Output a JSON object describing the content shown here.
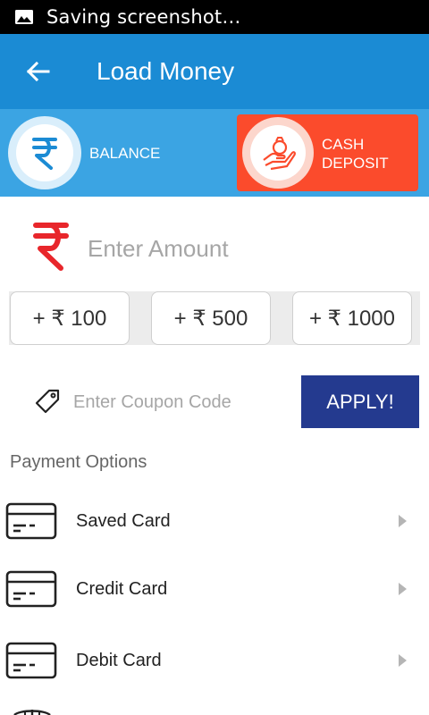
{
  "status_bar": {
    "icon": "image-icon",
    "text": "Saving screenshot…"
  },
  "app_bar": {
    "back_icon": "arrow-left-icon",
    "title": "Load Money",
    "color": "#1b8bd4"
  },
  "wallet_strip": {
    "color": "#3ba4e3",
    "balance": {
      "icon": "rupee-icon",
      "label": "BALANCE"
    },
    "cash_deposit": {
      "icon": "money-bag-hand-icon",
      "label_line1": "CASH",
      "label_line2": "DEPOSIT",
      "color": "#fb4b2c"
    }
  },
  "amount": {
    "icon": "rupee-icon",
    "placeholder": "Enter Amount",
    "value": "",
    "icon_color": "#e8262b"
  },
  "quick_amounts": [
    {
      "label": "+ ₹ 100"
    },
    {
      "label": "+ ₹ 500"
    },
    {
      "label": "+ ₹ 1000"
    }
  ],
  "coupon": {
    "icon": "tag-icon",
    "placeholder": "Enter Coupon Code",
    "value": "",
    "apply_label": "APPLY!",
    "apply_color": "#243a8f"
  },
  "payment": {
    "title": "Payment Options",
    "options": [
      {
        "icon": "card-icon",
        "label": "Saved Card"
      },
      {
        "icon": "card-icon",
        "label": "Credit Card"
      },
      {
        "icon": "card-icon",
        "label": "Debit Card"
      }
    ],
    "next_icon": "globe-icon"
  }
}
